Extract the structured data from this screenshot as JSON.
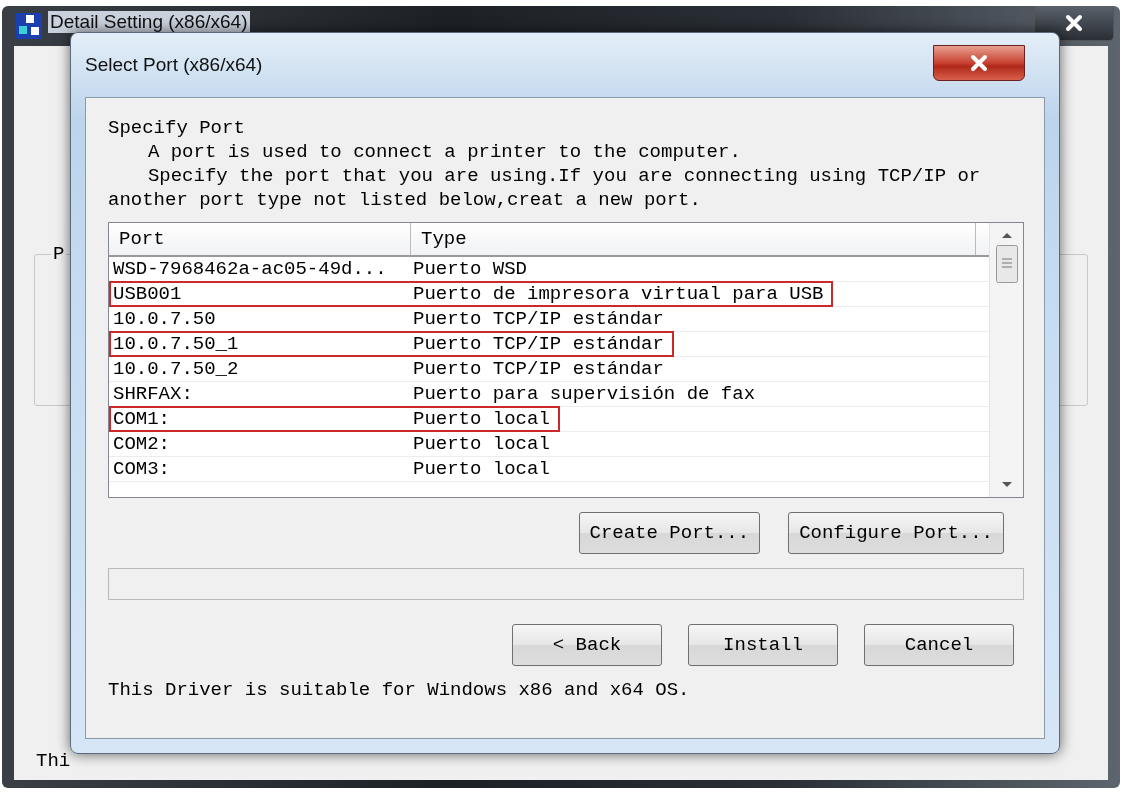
{
  "back_window": {
    "title": "Detail Setting (x86/x64)",
    "group_label": "P",
    "footer_text": "Thi"
  },
  "dialog": {
    "title": "Select Port (x86/x64)",
    "heading": "Specify Port",
    "intro": "A port is used to connect a printer to the computer.",
    "instructions": "Specify the port that you are using.If you are connecting using TCP/IP or another port type not listed below,creat a new port.",
    "columns": [
      "Port",
      "Type"
    ],
    "rows": [
      {
        "port": "WSD-7968462a-ac05-49d...",
        "type": "Puerto WSD",
        "highlighted": false
      },
      {
        "port": "USB001",
        "type": "Puerto de impresora virtual para USB",
        "highlighted": true
      },
      {
        "port": "10.0.7.50",
        "type": "Puerto TCP/IP estándar",
        "highlighted": false
      },
      {
        "port": "10.0.7.50_1",
        "type": "Puerto TCP/IP estándar",
        "highlighted": true
      },
      {
        "port": "10.0.7.50_2",
        "type": "Puerto TCP/IP estándar",
        "highlighted": false
      },
      {
        "port": "SHRFAX:",
        "type": "Puerto para supervisión de fax",
        "highlighted": false
      },
      {
        "port": "COM1:",
        "type": "Puerto local",
        "highlighted": true
      },
      {
        "port": "COM2:",
        "type": "Puerto local",
        "highlighted": false
      },
      {
        "port": "COM3:",
        "type": "Puerto local",
        "highlighted": false
      }
    ],
    "progress": {
      "level": 0
    },
    "port_buttons": [
      "Create Port...",
      "Configure Port..."
    ],
    "nav_buttons": [
      "< Back",
      "Install",
      "Cancel"
    ],
    "note": "This Driver is suitable for Windows x86 and x64 OS."
  }
}
